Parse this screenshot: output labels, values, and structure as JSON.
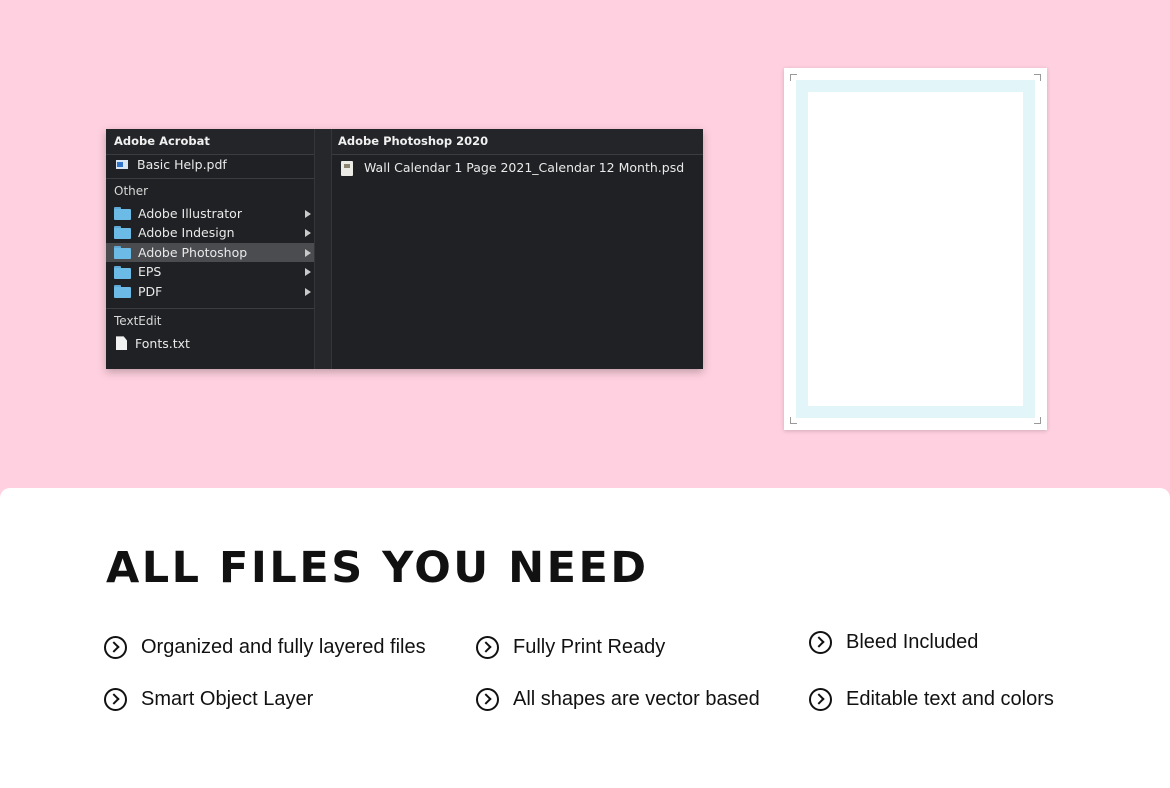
{
  "finder": {
    "left_column": {
      "section_acrobat": "Adobe Acrobat",
      "acrobat_items": [
        {
          "label": "Basic Help.pdf",
          "icon": "pdf-file-icon"
        }
      ],
      "section_other": "Other",
      "other_items": [
        {
          "label": "Adobe Illustrator",
          "icon": "folder-icon",
          "has_submenu": true
        },
        {
          "label": "Adobe Indesign",
          "icon": "folder-icon",
          "has_submenu": true
        },
        {
          "label": "Adobe Photoshop",
          "icon": "folder-icon",
          "has_submenu": true,
          "selected": true
        },
        {
          "label": "EPS",
          "icon": "folder-icon",
          "has_submenu": true
        },
        {
          "label": "PDF",
          "icon": "folder-icon",
          "has_submenu": true
        }
      ],
      "section_textedit": "TextEdit",
      "textedit_items": [
        {
          "label": "Fonts.txt",
          "icon": "text-file-icon"
        }
      ]
    },
    "right_column": {
      "section_title": "Adobe Photoshop 2020",
      "items": [
        {
          "label": "Wall Calendar 1 Page 2021_Calendar 12 Month.psd",
          "icon": "psd-file-icon"
        }
      ]
    }
  },
  "colors": {
    "background": "#ffd0df",
    "bleed_area": "#e2f5f9",
    "menu_background": "#1f2124",
    "folder": "#6cbbe6"
  },
  "card": {
    "headline": "ALL FILES YOU NEED",
    "features": [
      "Organized and fully layered files",
      "Fully Print Ready",
      "Bleed Included",
      "Smart Object Layer",
      "All shapes are vector based",
      "Editable text and colors"
    ]
  }
}
